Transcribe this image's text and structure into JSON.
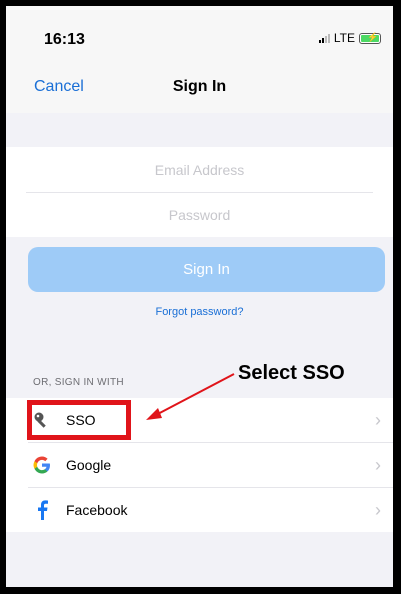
{
  "status": {
    "time": "16:13",
    "network": "LTE"
  },
  "nav": {
    "cancel_label": "Cancel",
    "title": "Sign In"
  },
  "form": {
    "email_placeholder": "Email Address",
    "password_placeholder": "Password",
    "signin_label": "Sign In",
    "forgot_label": "Forgot password?"
  },
  "providers": {
    "section_label": "OR, SIGN IN WITH",
    "items": [
      {
        "label": "SSO",
        "icon": "key-icon"
      },
      {
        "label": "Google",
        "icon": "google-icon"
      },
      {
        "label": "Facebook",
        "icon": "facebook-icon"
      }
    ]
  },
  "annotation": {
    "text": "Select SSO",
    "color": "#e0141a"
  },
  "colors": {
    "accent": "#1a6fd6",
    "button_disabled": "#9ecbf7"
  }
}
